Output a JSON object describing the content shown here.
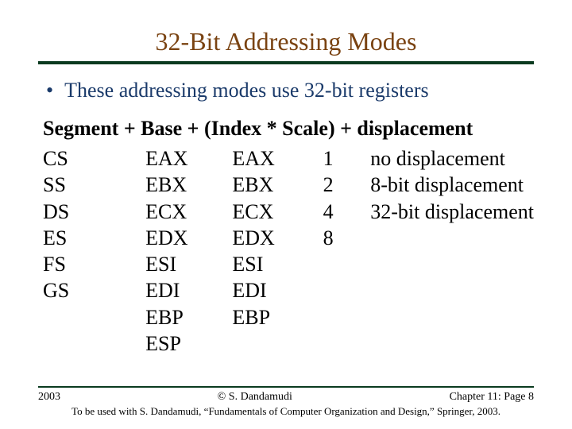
{
  "title": "32-Bit Addressing Modes",
  "bullet": "These addressing modes use 32-bit registers",
  "formula": "Segment + Base + (Index * Scale) + displacement",
  "columns": {
    "segment": [
      "CS",
      "SS",
      "DS",
      "ES",
      "FS",
      "GS"
    ],
    "base": [
      "EAX",
      "EBX",
      "ECX",
      "EDX",
      "ESI",
      "EDI",
      "EBP",
      "ESP"
    ],
    "index": [
      "EAX",
      "EBX",
      "ECX",
      "EDX",
      "ESI",
      "EDI",
      "EBP"
    ],
    "scale": [
      "1",
      "2",
      "4",
      "8"
    ],
    "displacement": [
      "no displacement",
      "8-bit displacement",
      "32-bit displacement"
    ]
  },
  "footer": {
    "year": "2003",
    "copyright": "© S. Dandamudi",
    "page": "Chapter 11: Page 8",
    "note": "To be used with S. Dandamudi, “Fundamentals of Computer Organization and Design,” Springer, 2003."
  }
}
